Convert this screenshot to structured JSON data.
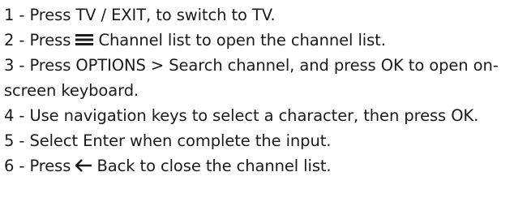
{
  "steps": [
    {
      "prefix": "1 - Press ",
      "key": "TV / EXIT",
      "suffix": ", to switch to TV."
    },
    {
      "prefix": "2 - Press ",
      "icon": "menu-list-icon",
      "key": "Channel list",
      "suffix": " to open the channel list."
    },
    {
      "prefix": "3 - Press ",
      "key": "OPTIONS",
      "middle": " > ",
      "key2": "Search channel",
      "middle2": ", and press ",
      "key3": "OK",
      "suffix": " to open on-screen keyboard."
    },
    {
      "prefix": "4 - Use navigation keys to select a character, then press ",
      "key": "OK",
      "suffix": "."
    },
    {
      "prefix": "5 - Select ",
      "key": "Enter",
      "suffix": " when complete the input."
    },
    {
      "prefix": "6 - Press ",
      "icon": "back-arrow-icon",
      "key": "Back",
      "suffix": " to close the channel list."
    }
  ]
}
